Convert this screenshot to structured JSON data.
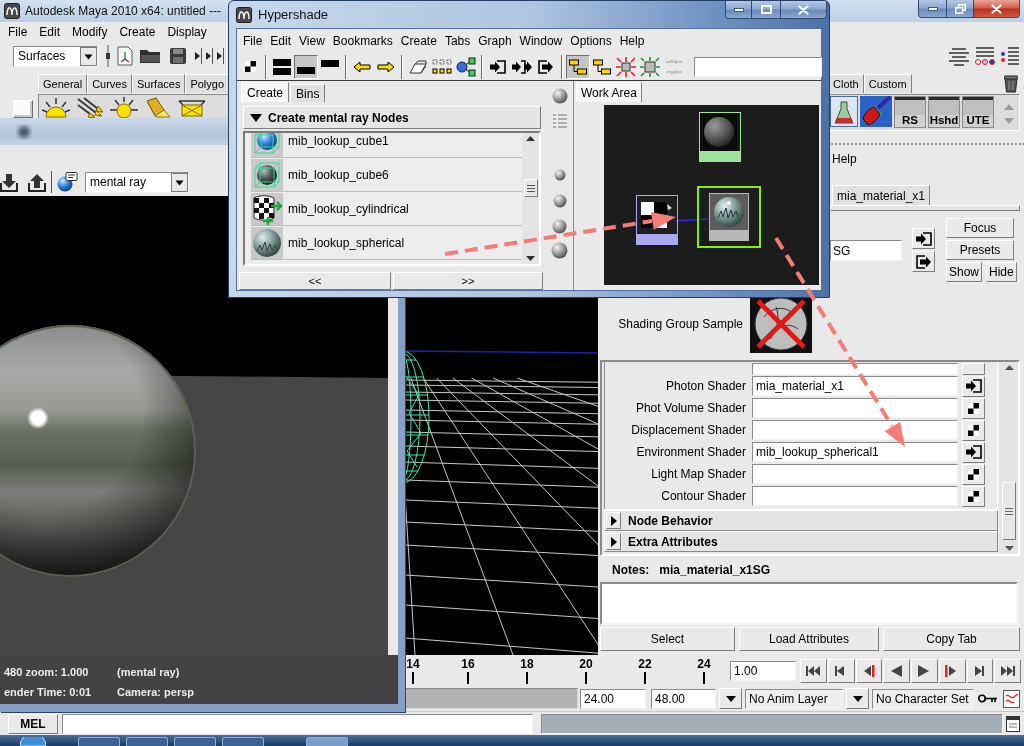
{
  "maya": {
    "title": "Autodesk Maya 2010 x64: untitled ---",
    "menu": [
      "File",
      "Edit",
      "Modify",
      "Create",
      "Display"
    ],
    "menu_set": "Surfaces",
    "shelf_tabs": {
      "left": [
        {
          "label": "General",
          "selected": false
        },
        {
          "label": "Curves",
          "selected": false
        },
        {
          "label": "Surfaces",
          "selected": false
        },
        {
          "label": "Polygo",
          "selected": false
        }
      ],
      "right": [
        {
          "label": "Cloth",
          "selected": false
        },
        {
          "label": "Custom",
          "selected": false
        }
      ]
    },
    "shelf_buttons": [
      "RS",
      "Hshd",
      "UTE"
    ]
  },
  "render_view": {
    "renderer": "mental ray",
    "info": [
      [
        "480 zoom: 1.000",
        "(mental ray)"
      ],
      [
        "ender Time: 0:01",
        "Camera: persp"
      ]
    ]
  },
  "hypershade": {
    "title": "Hypershade",
    "menu": [
      "File",
      "Edit",
      "View",
      "Bookmarks",
      "Create",
      "Tabs",
      "Graph",
      "Window",
      "Options",
      "Help"
    ],
    "toolbar": [
      [
        {
          "kind": "checker",
          "pressed": false
        }
      ],
      [
        {
          "kind": "split",
          "pressed": false
        },
        {
          "kind": "bottom",
          "pressed": true
        },
        {
          "kind": "top",
          "pressed": false
        }
      ],
      [
        {
          "kind": "back",
          "pressed": false
        },
        {
          "kind": "forward",
          "pressed": false
        }
      ],
      [
        {
          "kind": "eraser",
          "pressed": false
        },
        {
          "kind": "grid",
          "pressed": false
        },
        {
          "kind": "network",
          "pressed": false
        }
      ],
      [
        {
          "kind": "input",
          "pressed": false
        },
        {
          "kind": "inout",
          "pressed": false
        },
        {
          "kind": "output",
          "pressed": false
        }
      ],
      [
        {
          "kind": "layout",
          "pressed": true
        },
        {
          "kind": "layout",
          "pressed": false
        },
        {
          "kind": "shrink",
          "pressed": false
        },
        {
          "kind": "expand",
          "pressed": false
        },
        {
          "kind": "dimmed",
          "pressed": false
        }
      ]
    ],
    "tabs": [
      {
        "label": "Create",
        "selected": true
      },
      {
        "label": "Bins",
        "selected": false
      }
    ],
    "section": {
      "title": "Create mental ray Nodes",
      "expanded": true
    },
    "nodes": [
      {
        "name": "mib_lookup_cube1",
        "kind": "cube"
      },
      {
        "name": "mib_lookup_cube6",
        "kind": "box"
      },
      {
        "name": "mib_lookup_cylindrical",
        "kind": "cylinder"
      },
      {
        "name": "mib_lookup_spherical",
        "kind": "sphere"
      }
    ],
    "pager": [
      "<<",
      ">>"
    ],
    "work_tabs": [
      {
        "label": "Work Area",
        "selected": true
      }
    ],
    "graph_nodes": [
      {
        "kind": "material",
        "color": "#9fe39a",
        "selected": false
      },
      {
        "kind": "texture",
        "color": "#a9a9f2",
        "selected": false
      },
      {
        "kind": "lookup",
        "color": "#b9b9b9",
        "selected": true
      }
    ]
  },
  "attribute_editor": {
    "menu": [
      "Help"
    ],
    "tabs": [
      {
        "label": "mia_material_x1",
        "selected": false
      }
    ],
    "name": "SG",
    "side_buttons": [
      "Focus",
      "Presets",
      "Show",
      "Hide"
    ],
    "sample_label": "Shading Group Sample",
    "shaders": [
      {
        "label": "Photon Shader",
        "value": "mia_material_x1",
        "connected": true
      },
      {
        "label": "Phot Volume Shader",
        "connected": false
      },
      {
        "label": "Displacement Shader",
        "connected": false
      },
      {
        "label": "Environment Shader",
        "value": "mib_lookup_spherical1",
        "connected": true
      },
      {
        "label": "Light Map Shader",
        "connected": false
      },
      {
        "label": "Contour Shader",
        "connected": false
      }
    ],
    "sections": [
      {
        "title": "Node Behavior",
        "expanded": false
      },
      {
        "title": "Extra Attributes",
        "expanded": false
      }
    ],
    "notes_label": "Notes:",
    "notes_node": "mia_material_x1SG",
    "buttons": [
      "Select",
      "Load Attributes",
      "Copy Tab"
    ]
  },
  "time_slider": {
    "frames": [
      "14",
      "16",
      "18",
      "20",
      "22",
      "24"
    ],
    "current_time": "1.00"
  },
  "range_slider": {
    "playback_end": "24.00",
    "animation_end": "48.00",
    "anim_layer": "No Anim Layer",
    "character_set": "No Character Set"
  },
  "command_line": {
    "language": "MEL"
  }
}
